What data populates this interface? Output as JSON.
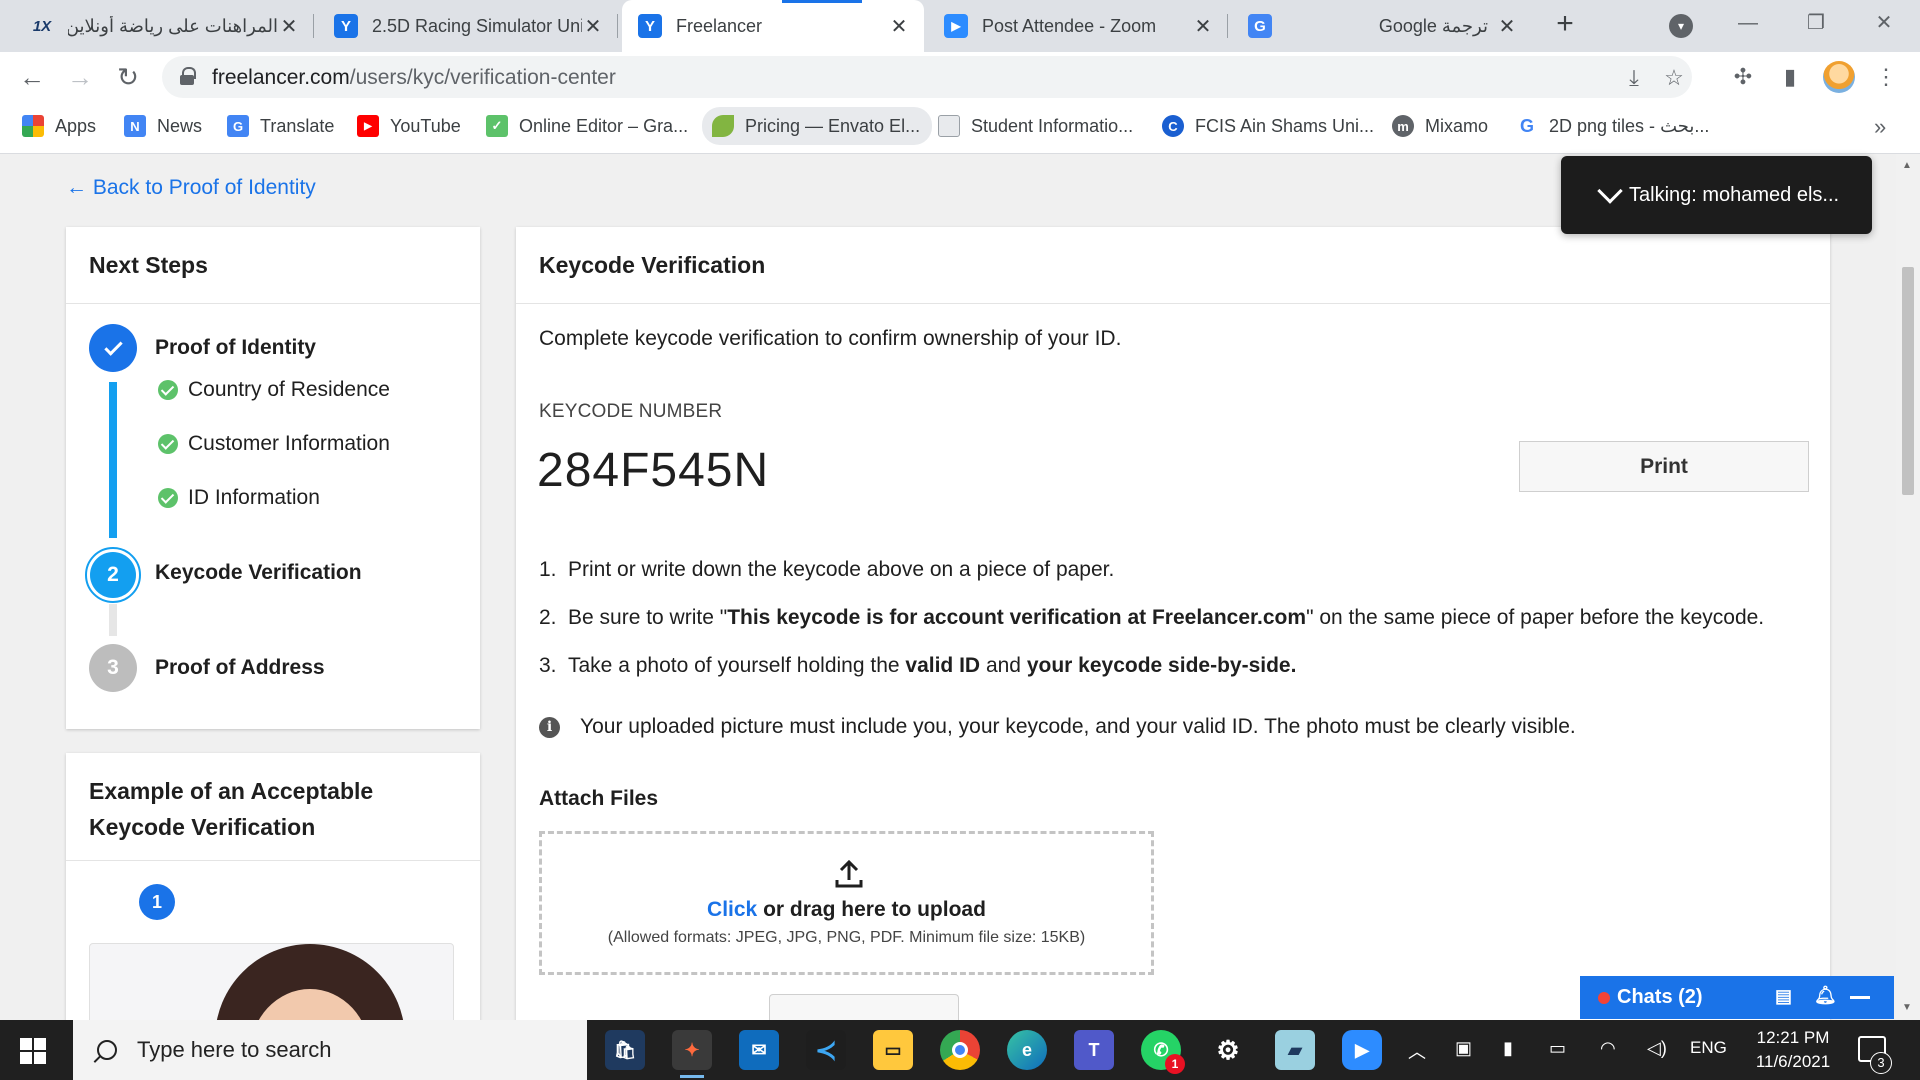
{
  "browser": {
    "tabs": [
      {
        "title": "المراهنات على رياضة أونلاين",
        "favicon": "1x-icon",
        "color": "#1a3a6a"
      },
      {
        "title": "2.5D Racing Simulator Uni",
        "favicon": "freelancer-icon",
        "color": "#1a73e8"
      },
      {
        "title": "Freelancer",
        "favicon": "freelancer-icon",
        "color": "#1a73e8",
        "active": true
      },
      {
        "title": "Post Attendee - Zoom",
        "favicon": "zoom-icon",
        "color": "#2d8cff"
      },
      {
        "title": "Google ترجمة",
        "favicon": "google-translate-icon",
        "color": "#4285f4"
      }
    ],
    "close_glyph": "✕",
    "new_tab_glyph": "+",
    "window_controls": {
      "minimize": "—",
      "restore": "❐",
      "close": "✕"
    },
    "url_host": "freelancer.com",
    "url_path": "/users/kyc/verification-center"
  },
  "bookmarks": [
    {
      "label": "Apps",
      "icon": "apps-grid-icon",
      "color": "#ea4335"
    },
    {
      "label": "News",
      "icon": "google-news-icon",
      "color": "#4285f4"
    },
    {
      "label": "Translate",
      "icon": "google-translate-icon",
      "color": "#4285f4"
    },
    {
      "label": "YouTube",
      "icon": "youtube-icon",
      "color": "#ff0000"
    },
    {
      "label": "Online Editor – Gra...",
      "icon": "grammarly-check-icon",
      "color": "#5dc26a"
    },
    {
      "label": "Pricing — Envato El...",
      "icon": "envato-leaf-icon",
      "color": "#82b541"
    },
    {
      "label": "Student Informatio...",
      "icon": "document-icon",
      "color": "#9aa0a6"
    },
    {
      "label": "FCIS Ain Shams Uni...",
      "icon": "fcis-c-icon",
      "color": "#1a5fd1"
    },
    {
      "label": "Mixamo",
      "icon": "mixamo-icon",
      "color": "#5f6368"
    },
    {
      "label": "2D png tiles - بحث...",
      "icon": "google-g-icon",
      "color": "#4285f4"
    }
  ],
  "page": {
    "back_link": "← Back to Proof of Identity",
    "next_steps": {
      "title": "Next Steps",
      "steps": [
        {
          "label": "Proof of Identity",
          "state": "done"
        },
        {
          "label": "Keycode Verification",
          "number": "2",
          "state": "current"
        },
        {
          "label": "Proof of Address",
          "number": "3",
          "state": "pending"
        }
      ],
      "substeps": [
        "Country of Residence",
        "Customer Information",
        "ID Information"
      ]
    },
    "example": {
      "title": "Example of an Acceptable Keycode Verification",
      "marker": "1"
    },
    "verification": {
      "title": "Keycode Verification",
      "intro": "Complete keycode verification to confirm ownership of your ID.",
      "keycode_label": "KEYCODE NUMBER",
      "keycode": "284F545N",
      "print_label": "Print",
      "instructions": {
        "i1": {
          "num": "1.",
          "text": "Print or write down the keycode above on a piece of paper."
        },
        "i2": {
          "num": "2.",
          "pre": "Be sure to write \"",
          "bold": "This keycode is for account verification at Freelancer.com",
          "post": "\" on the same piece of paper before the keycode."
        },
        "i3": {
          "num": "3.",
          "pre": "Take a photo of yourself holding the ",
          "bold1": "valid ID",
          "mid": " and ",
          "bold2": "your keycode side-by-side."
        }
      },
      "info": "Your uploaded picture must include you, your keycode, and your valid ID. The photo must be clearly visible.",
      "attach_title": "Attach Files",
      "upload_click": "Click",
      "upload_rest": " or drag here to upload",
      "upload_formats": "(Allowed formats: JPEG, JPG, PNG, PDF. Minimum file size: 15KB)"
    },
    "zoom_toast": "Talking:  mohamed  els...",
    "chats_label": "Chats (2)"
  },
  "taskbar": {
    "search_placeholder": "Type here to search",
    "language": "ENG",
    "time": "12:21 PM",
    "date": "11/6/2021",
    "whatsapp_badge": "1",
    "notification_count": "3"
  }
}
